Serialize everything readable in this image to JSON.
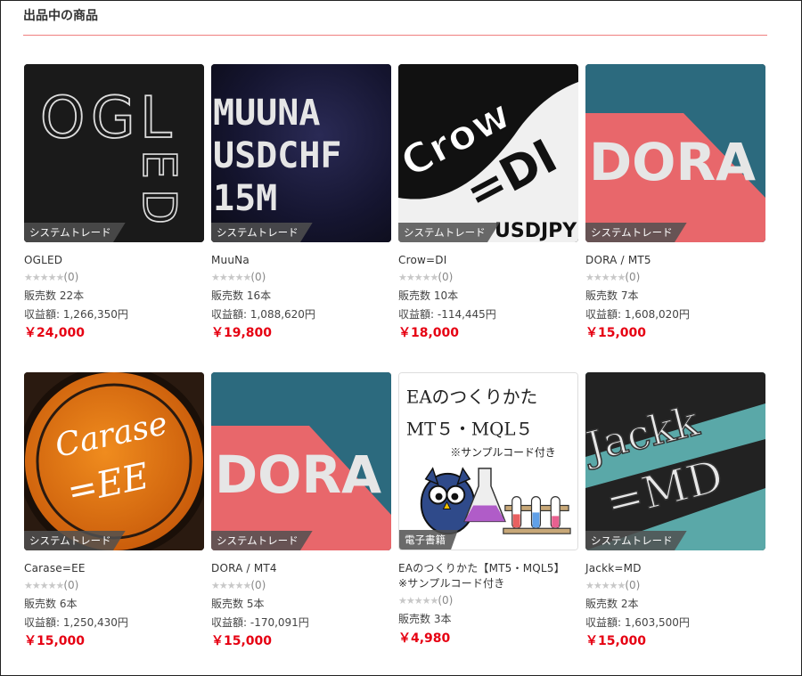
{
  "section_title": "出品中の商品",
  "colors": {
    "price": "#e60012",
    "divider": "#f08080"
  },
  "products": [
    {
      "title": "OGLED",
      "category": "システムトレード",
      "rating_count": "(0)",
      "sales": "販売数 22本",
      "revenue": "収益額: 1,266,350円",
      "price": "￥24,000",
      "stars": "★★★★★",
      "image_text": [
        "O",
        "G",
        "L",
        "E",
        "D"
      ]
    },
    {
      "title": "MuuNa",
      "category": "システムトレード",
      "rating_count": "(0)",
      "sales": "販売数 16本",
      "revenue": "収益額: 1,088,620円",
      "price": "￥19,800",
      "stars": "★★★★★",
      "image_text": [
        "MUUNA",
        "USDCHF",
        "15M"
      ]
    },
    {
      "title": "Crow=DI",
      "category": "システムトレード",
      "rating_count": "(0)",
      "sales": "販売数 10本",
      "revenue": "収益額: -114,445円",
      "price": "￥18,000",
      "stars": "★★★★★",
      "image_text": [
        "Crow",
        "=DI",
        "USDJPY"
      ]
    },
    {
      "title": "DORA / MT5",
      "category": "システムトレード",
      "rating_count": "(0)",
      "sales": "販売数 7本",
      "revenue": "収益額: 1,608,020円",
      "price": "￥15,000",
      "stars": "★★★★★",
      "image_text": [
        "DORA"
      ]
    },
    {
      "title": "Carase=EE",
      "category": "システムトレード",
      "rating_count": "(0)",
      "sales": "販売数 6本",
      "revenue": "収益額: 1,250,430円",
      "price": "￥15,000",
      "stars": "★★★★★",
      "image_text": [
        "Carase",
        "=EE"
      ]
    },
    {
      "title": "DORA / MT4",
      "category": "システムトレード",
      "rating_count": "(0)",
      "sales": "販売数 5本",
      "revenue": "収益額: -170,091円",
      "price": "￥15,000",
      "stars": "★★★★★",
      "image_text": [
        "DORA"
      ]
    },
    {
      "title": "EAのつくりかた【MT5・MQL5】※サンプルコード付き",
      "category": "電子書籍",
      "rating_count": "(0)",
      "sales": "販売数 3本",
      "revenue": "",
      "price": "￥4,980",
      "stars": "★★★★★",
      "image_text": [
        "EAのつくりかた",
        "MT５・MQL５",
        "※サンプルコード付き"
      ]
    },
    {
      "title": "Jackk=MD",
      "category": "システムトレード",
      "rating_count": "(0)",
      "sales": "販売数 2本",
      "revenue": "収益額: 1,603,500円",
      "price": "￥15,000",
      "stars": "★★★★★",
      "image_text": [
        "Jackk",
        "=MD"
      ]
    }
  ]
}
